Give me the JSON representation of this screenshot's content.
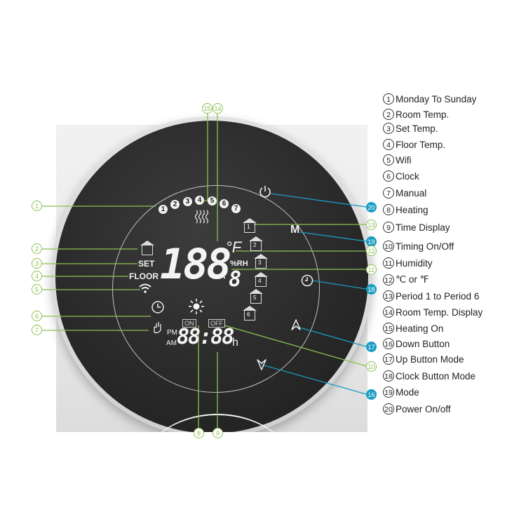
{
  "display": {
    "days": [
      "1",
      "2",
      "3",
      "4",
      "5",
      "6",
      "7"
    ],
    "main_digits": "188",
    "decimal_digit": "8",
    "unit": "°F",
    "humidity_label": "%RH",
    "set_label": "SET",
    "floor_label": "FLOOR",
    "time_digits": "88:88",
    "time_suffix": "h",
    "pm_label": "PM",
    "am_label": "AM",
    "on_tag": "ON",
    "off_tag": "OFF",
    "periods": [
      "1",
      "2",
      "3",
      "4",
      "5",
      "6"
    ],
    "mode_button": "M"
  },
  "callouts": {
    "left": [
      "1",
      "2",
      "3",
      "4",
      "5",
      "6",
      "7"
    ],
    "top": [
      "15",
      "14"
    ],
    "bottom": [
      "8",
      "9"
    ],
    "right_green": [
      "13",
      "12",
      "11",
      "10"
    ],
    "right_blue": [
      "20",
      "19",
      "18",
      "17",
      "16"
    ]
  },
  "legend": [
    {
      "num": "1",
      "label": "Monday To Sunday"
    },
    {
      "num": "2",
      "label": "Room Temp."
    },
    {
      "num": "3",
      "label": "Set Temp."
    },
    {
      "num": "4",
      "label": "Floor Temp."
    },
    {
      "num": "5",
      "label": "Wifi"
    },
    {
      "num": "6",
      "label": "Clock"
    },
    {
      "num": "7",
      "label": "Manual"
    },
    {
      "num": "8",
      "label": "Heating"
    },
    {
      "num": "9",
      "label": "Time Display"
    },
    {
      "num": "10",
      "label": "Timing On/Off"
    },
    {
      "num": "11",
      "label": "Humidity"
    },
    {
      "num": "12",
      "label": "℃ or ℉"
    },
    {
      "num": "13",
      "label": "Period 1 to Period 6"
    },
    {
      "num": "14",
      "label": "Room Temp. Display"
    },
    {
      "num": "15",
      "label": "Heating On"
    },
    {
      "num": "16",
      "label": "Down Button"
    },
    {
      "num": "17",
      "label": "Up Button Mode"
    },
    {
      "num": "18",
      "label": "Clock Button Mode"
    },
    {
      "num": "19",
      "label": "Mode"
    },
    {
      "num": "20",
      "label": "Power On/off"
    }
  ],
  "colors": {
    "callout_green": "#8cc152",
    "callout_blue": "#1b9cc4",
    "face": "#2a2a2a"
  }
}
